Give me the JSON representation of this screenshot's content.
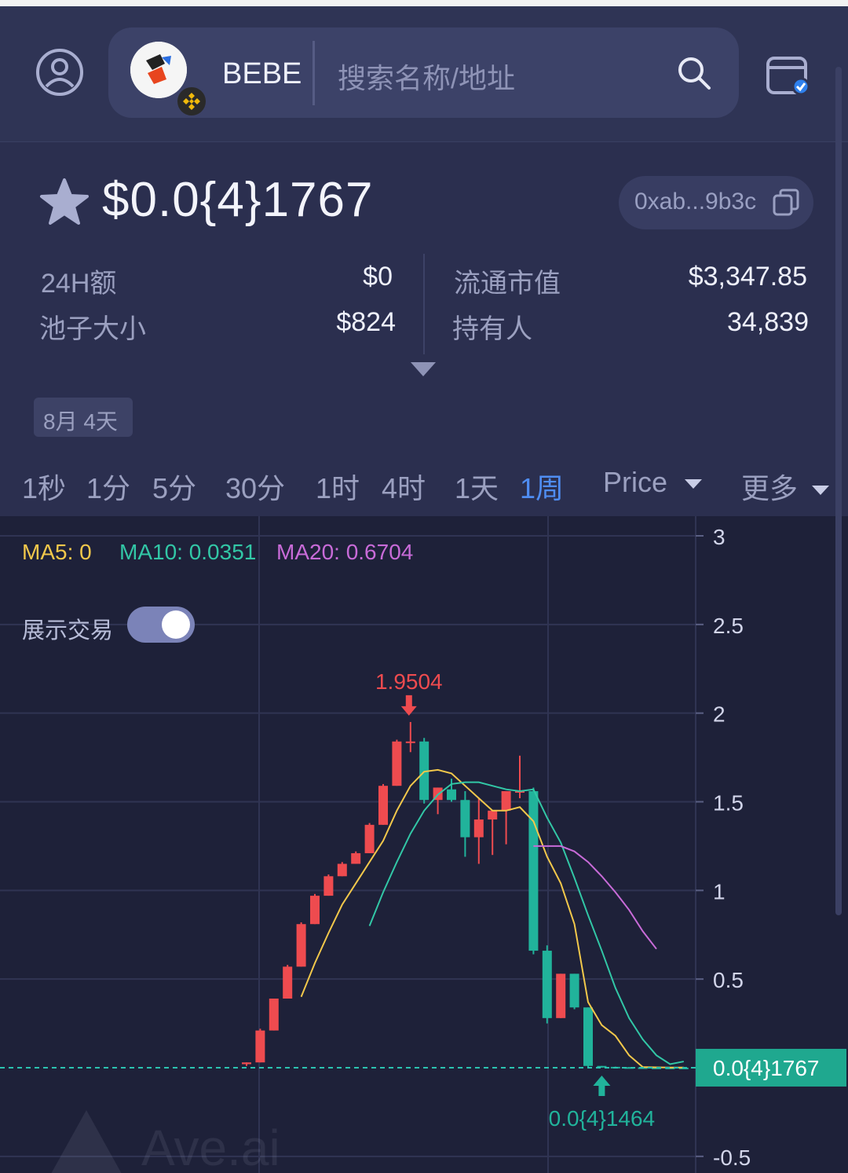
{
  "header": {
    "token_name": "BEBE",
    "search_placeholder": "搜索名称/地址"
  },
  "token": {
    "price": "$0.0{4}1767",
    "address": "0xab...9b3c"
  },
  "stats": {
    "volume_24h_label": "24H额",
    "volume_24h_value": "$0",
    "pool_label": "池子大小",
    "pool_value": "$824",
    "mcap_label": "流通市值",
    "mcap_value": "$3,347.85",
    "holders_label": "持有人",
    "holders_value": "34,839"
  },
  "age_chip": "8月 4天",
  "timeframes": [
    "1秒",
    "1分",
    "5分",
    "30分",
    "1时",
    "4时",
    "1天",
    "1周"
  ],
  "active_timeframe_index": 7,
  "controls": {
    "price_label": "Price",
    "more_label": "更多"
  },
  "indicators": {
    "ma5_label": "MA5: 0",
    "ma10_label": "MA10: 0.0351",
    "ma20_label": "MA20: 0.6704"
  },
  "toggle": {
    "label": "展示交易",
    "on": true
  },
  "colors": {
    "up": "#ee4b4f",
    "down": "#21b39b",
    "ma5": "#f2c84b",
    "ma10": "#32c7a6",
    "ma20": "#c86bd8",
    "accent": "#4f8df2"
  },
  "chart_data": {
    "type": "candlestick",
    "y_ticks": [
      "3",
      "2.5",
      "2",
      "1.5",
      "1",
      "0.5",
      "-0.5"
    ],
    "ylim": [
      -0.5,
      3
    ],
    "current_price_label": "0.0{4}1767",
    "current_price_value": 0.0001767,
    "high_label": "1.9504",
    "high_value": 1.9504,
    "low_label": "0.0{4}1464",
    "low_value": 0.0001464,
    "grid": true,
    "candles": [
      {
        "o": 0.02,
        "h": 0.03,
        "l": 0.01,
        "c": 0.03
      },
      {
        "o": 0.03,
        "h": 0.22,
        "l": 0.03,
        "c": 0.21
      },
      {
        "o": 0.21,
        "h": 0.39,
        "l": 0.21,
        "c": 0.39
      },
      {
        "o": 0.39,
        "h": 0.58,
        "l": 0.39,
        "c": 0.57
      },
      {
        "o": 0.57,
        "h": 0.82,
        "l": 0.57,
        "c": 0.81
      },
      {
        "o": 0.81,
        "h": 0.98,
        "l": 0.81,
        "c": 0.97
      },
      {
        "o": 0.97,
        "h": 1.09,
        "l": 0.97,
        "c": 1.08
      },
      {
        "o": 1.08,
        "h": 1.16,
        "l": 1.08,
        "c": 1.15
      },
      {
        "o": 1.15,
        "h": 1.22,
        "l": 1.15,
        "c": 1.21
      },
      {
        "o": 1.21,
        "h": 1.38,
        "l": 1.21,
        "c": 1.37
      },
      {
        "o": 1.37,
        "h": 1.6,
        "l": 1.37,
        "c": 1.59
      },
      {
        "o": 1.59,
        "h": 1.85,
        "l": 1.59,
        "c": 1.84
      },
      {
        "o": 1.84,
        "h": 1.95,
        "l": 1.78,
        "c": 1.84
      },
      {
        "o": 1.84,
        "h": 1.86,
        "l": 1.49,
        "c": 1.51
      },
      {
        "o": 1.51,
        "h": 1.58,
        "l": 1.43,
        "c": 1.58
      },
      {
        "o": 1.57,
        "h": 1.63,
        "l": 1.5,
        "c": 1.51
      },
      {
        "o": 1.51,
        "h": 1.56,
        "l": 1.19,
        "c": 1.3
      },
      {
        "o": 1.3,
        "h": 1.52,
        "l": 1.15,
        "c": 1.4
      },
      {
        "o": 1.4,
        "h": 1.45,
        "l": 1.2,
        "c": 1.45
      },
      {
        "o": 1.45,
        "h": 1.56,
        "l": 1.26,
        "c": 1.56
      },
      {
        "o": 1.56,
        "h": 1.76,
        "l": 1.52,
        "c": 1.56
      },
      {
        "o": 1.56,
        "h": 1.58,
        "l": 0.64,
        "c": 0.66
      },
      {
        "o": 0.66,
        "h": 0.69,
        "l": 0.25,
        "c": 0.28
      },
      {
        "o": 0.28,
        "h": 0.53,
        "l": 0.28,
        "c": 0.53
      },
      {
        "o": 0.53,
        "h": 0.53,
        "l": 0.33,
        "c": 0.34
      },
      {
        "o": 0.34,
        "h": 0.34,
        "l": 0.0001464,
        "c": 0.01
      },
      {
        "o": 0.01,
        "h": 0.01,
        "l": 0.0001,
        "c": 0.005
      },
      {
        "o": 0.005,
        "h": 0.006,
        "l": 0.0001,
        "c": 0.003
      },
      {
        "o": 0.003,
        "h": 0.004,
        "l": 0.0001,
        "c": 0.002
      },
      {
        "o": 0.002,
        "h": 0.003,
        "l": 0.0001,
        "c": 0.001
      },
      {
        "o": 0.001,
        "h": 0.002,
        "l": 0.0001,
        "c": 0.0008
      },
      {
        "o": 0.0008,
        "h": 0.001,
        "l": 0.0001,
        "c": 0.0005
      },
      {
        "o": 0.0005,
        "h": 0.0008,
        "l": 0.0001,
        "c": 0.0003
      }
    ],
    "ma5": [
      null,
      null,
      null,
      null,
      0.4,
      0.59,
      0.76,
      0.92,
      1.04,
      1.16,
      1.28,
      1.45,
      1.59,
      1.67,
      1.68,
      1.66,
      1.59,
      1.52,
      1.45,
      1.45,
      1.47,
      1.39,
      1.19,
      1.04,
      0.81,
      0.37,
      0.24,
      0.18,
      0.07,
      0.004,
      0.002,
      0.001,
      0.001
    ],
    "ma10": [
      null,
      null,
      null,
      null,
      null,
      null,
      null,
      null,
      null,
      0.8,
      0.99,
      1.16,
      1.32,
      1.45,
      1.54,
      1.6,
      1.61,
      1.61,
      1.59,
      1.57,
      1.56,
      1.57,
      1.41,
      1.27,
      1.07,
      0.86,
      0.66,
      0.45,
      0.28,
      0.16,
      0.07,
      0.02,
      0.0351
    ],
    "ma20": [
      null,
      null,
      null,
      null,
      null,
      null,
      null,
      null,
      null,
      null,
      null,
      null,
      null,
      null,
      null,
      null,
      null,
      null,
      null,
      null,
      null,
      1.25,
      1.25,
      1.25,
      1.22,
      1.16,
      1.08,
      0.99,
      0.89,
      0.77,
      0.67
    ]
  }
}
